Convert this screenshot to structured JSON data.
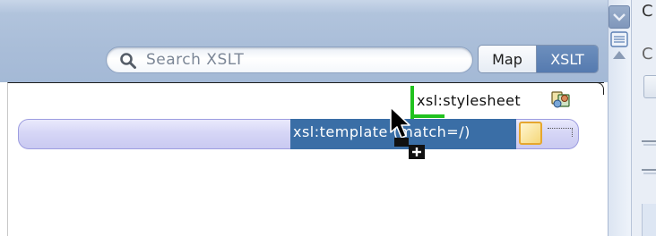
{
  "search": {
    "placeholder": "Search XSLT"
  },
  "view_toggle": {
    "map_label": "Map",
    "xslt_label": "XSLT",
    "selected": "XSLT"
  },
  "nodes": {
    "stylesheet_label": "xsl:stylesheet",
    "template_label": "xsl:template (match=/)"
  },
  "right_panel": {
    "top_char": "C",
    "mid_char": "C"
  },
  "colors": {
    "header_blue": "#a9bdd8",
    "selected_toggle": "#557aaf",
    "template_selection": "#3a6ea6",
    "template_bar": "#d6d6f6",
    "connector_green": "#21c21f",
    "template_icon_border": "#e6a72e"
  },
  "icons": {
    "search": "search-icon",
    "stylesheet": "stylesheet-node-icon",
    "template": "template-node-icon",
    "cursor": "drag-copy-cursor-icon"
  }
}
